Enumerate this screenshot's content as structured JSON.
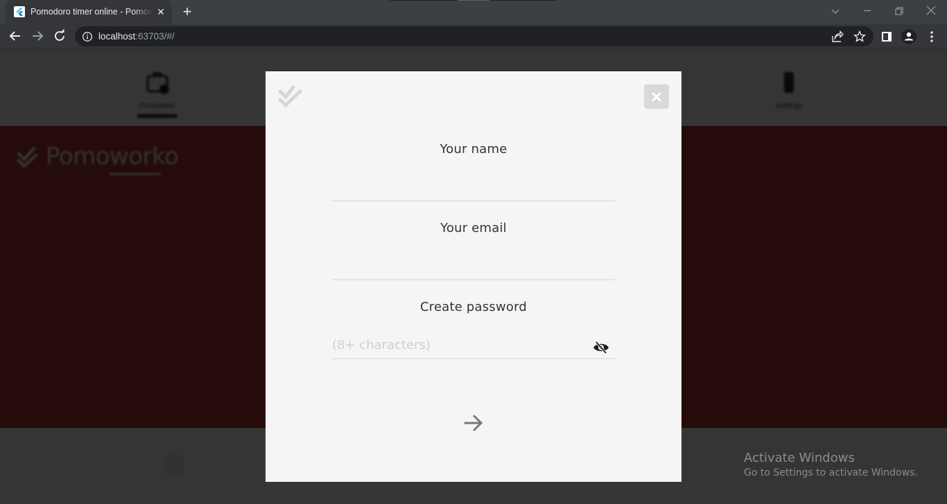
{
  "browser": {
    "tab": {
      "title": "Pomodoro timer online - Pomoworko",
      "favicon": "flutter-logo-icon"
    },
    "new_tab_icon": "plus-icon",
    "window_controls": [
      "tab-search-chevron-icon",
      "minimize-icon",
      "restore-icon",
      "close-icon"
    ],
    "omnibox": {
      "host": "localhost",
      "rest": ":63703/#/",
      "icons": [
        "site-info-icon",
        "share-icon",
        "bookmark-star-icon"
      ]
    },
    "toolbar_icons": [
      "back-icon",
      "forward-icon",
      "reload-icon",
      "side-panel-icon",
      "profile-icon",
      "menu-kebab-icon"
    ]
  },
  "app": {
    "brand": "Pomoworko",
    "nav": [
      {
        "label": "Pomodoro",
        "icon": "briefcase-clock-icon",
        "active": true
      },
      {
        "label": "Settings",
        "icon": "phone-icon",
        "active": false
      }
    ],
    "colors": {
      "hero": "#a8352d",
      "overlay": "rgba(0,0,0,0.78)",
      "modal_bg": "#f5f5f5"
    }
  },
  "modal": {
    "logo_icon": "double-check-icon",
    "close_icon": "close-x-icon",
    "fields": {
      "name": {
        "label": "Your name",
        "value": "",
        "placeholder": ""
      },
      "email": {
        "label": "Your email",
        "value": "",
        "placeholder": ""
      },
      "password": {
        "label": "Create password",
        "value": "",
        "placeholder": "(8+ characters)",
        "toggle_icon": "eye-off-icon"
      }
    },
    "submit_icon": "arrow-right-icon"
  },
  "watermark": {
    "title": "Activate Windows",
    "subtitle": "Go to Settings to activate Windows."
  }
}
